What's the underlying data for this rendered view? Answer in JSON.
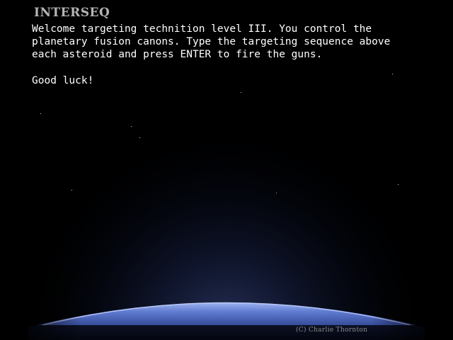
{
  "game": {
    "title": "INTERSEQ",
    "intro_lines": [
      "Welcome targeting technition level III. You control the",
      "planetary fusion canons. Type the targeting sequence above",
      "each asteroid and press ENTER to fire the guns."
    ],
    "farewell": "Good luck!",
    "copyright": "(C) Charlie Thornton"
  },
  "colors": {
    "background": "#000000",
    "title": "#b5b5b5",
    "text": "#ffffff",
    "copyright": "#8c8c8c",
    "planet_glow": "#6a86d8"
  }
}
